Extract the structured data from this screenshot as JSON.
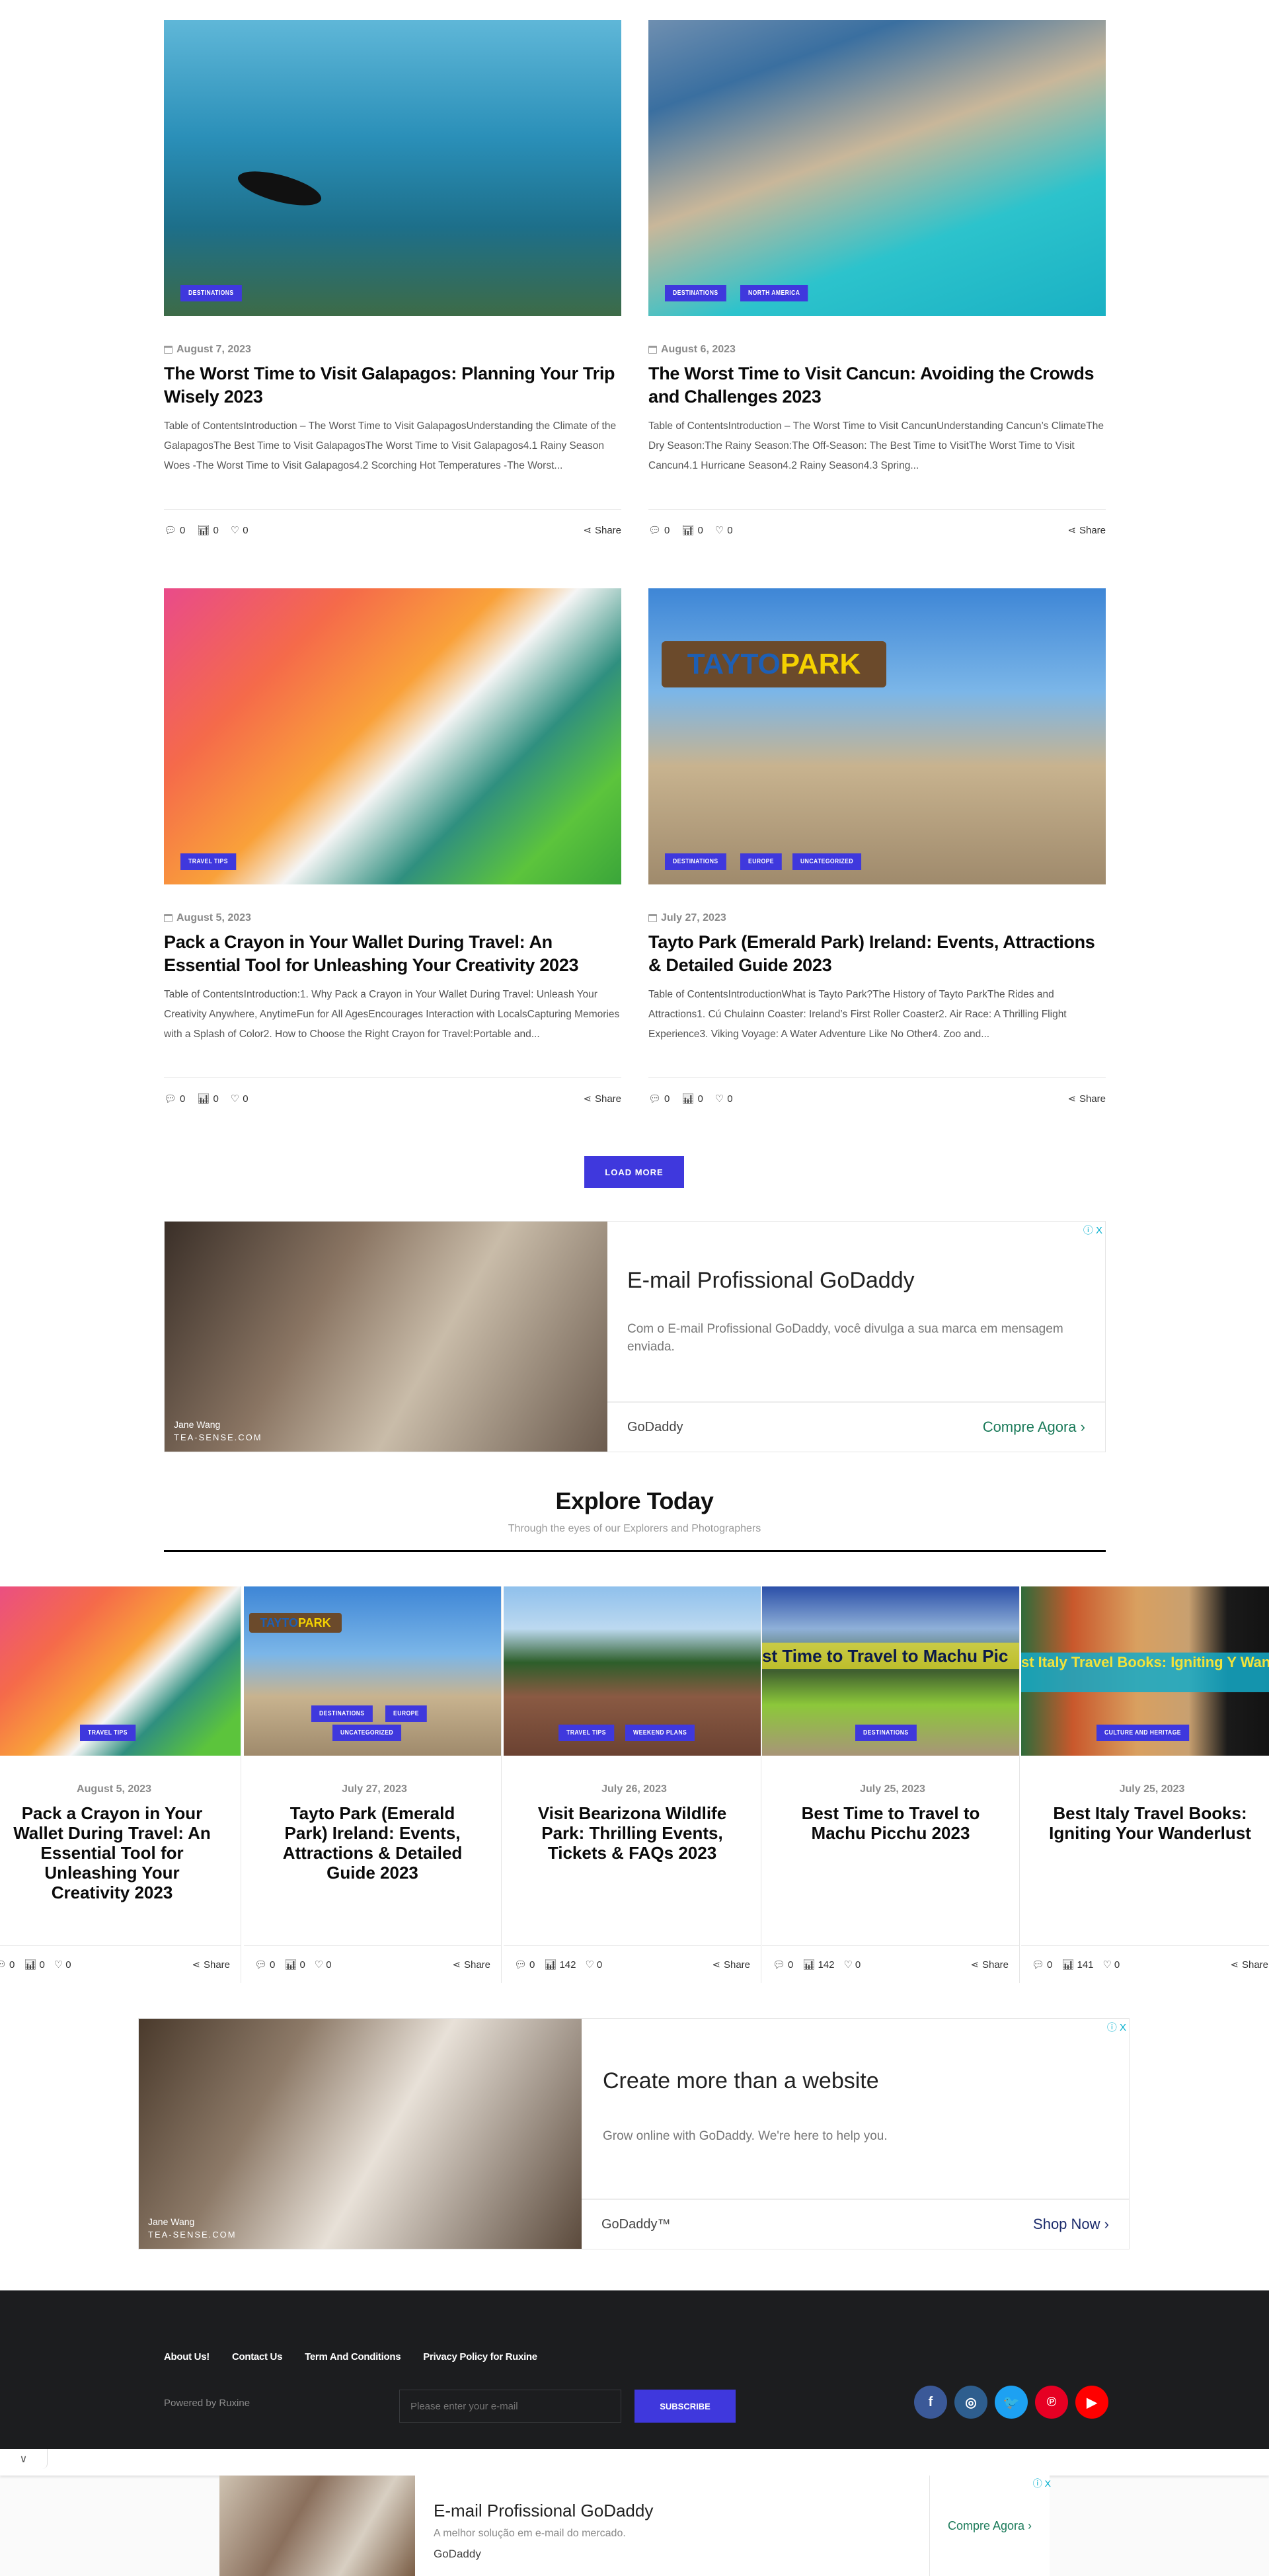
{
  "posts": [
    {
      "date": "August 7, 2023",
      "title": "The Worst Time to Visit Galapagos: Planning Your Trip Wisely 2023",
      "excerpt": "Table of ContentsIntroduction – The Worst Time to Visit GalapagosUnderstanding the Climate of the GalapagosThe Best Time to Visit GalapagosThe Worst Time to Visit Galapagos4.1 Rainy Season Woes -The Worst Time to Visit Galapagos4.2 Scorching Hot Temperatures -The Worst...",
      "categories": [
        "Destinations"
      ],
      "comments": "0",
      "views": "0",
      "likes": "0",
      "share": "Share"
    },
    {
      "date": "August 6, 2023",
      "title": "The Worst Time to Visit Cancun: Avoiding the Crowds and Challenges 2023",
      "excerpt": "Table of ContentsIntroduction – The Worst Time to Visit CancunUnderstanding Cancun’s ClimateThe Dry Season:The Rainy Season:The Off-Season: The Best Time to VisitThe Worst Time to Visit Cancun4.1 Hurricane Season4.2 Rainy Season4.3 Spring...",
      "categories": [
        "Destinations",
        "North America"
      ],
      "comments": "0",
      "views": "0",
      "likes": "0",
      "share": "Share"
    },
    {
      "date": "August 5, 2023",
      "title": "Pack a Crayon in Your Wallet During Travel: An Essential Tool for Unleashing Your Creativity 2023",
      "excerpt": "Table of ContentsIntroduction:1. Why Pack a Crayon in Your Wallet During Travel: Unleash Your Creativity Anywhere, AnytimeFun for All AgesEncourages Interaction with LocalsCapturing Memories with a Splash of Color2. How to Choose the Right Crayon for Travel:Portable and...",
      "categories": [
        "Travel Tips"
      ],
      "comments": "0",
      "views": "0",
      "likes": "0",
      "share": "Share"
    },
    {
      "date": "July 27, 2023",
      "title": "Tayto Park (Emerald Park) Ireland: Events, Attractions & Detailed Guide 2023",
      "excerpt": "Table of ContentsIntroductionWhat is Tayto Park?The History of Tayto ParkThe Rides and Attractions1. Cú Chulainn Coaster: Ireland’s First Roller Coaster2. Air Race: A Thrilling Flight Experience3. Viking Voyage: A Water Adventure Like No Other4. Zoo and...",
      "categories": [
        "Destinations",
        "Europe",
        "Uncategorized"
      ],
      "comments": "0",
      "views": "0",
      "likes": "0",
      "share": "Share"
    }
  ],
  "load_more_label": "LOAD MORE",
  "ad1": {
    "headline": "E-mail Profissional GoDaddy",
    "description": "Com o E-mail Profissional GoDaddy, você divulga a sua marca em mensagem enviada.",
    "brand": "GoDaddy",
    "cta": "Compre Agora",
    "caption_name": "Jane Wang",
    "caption_site": "TEA-SENSE.COM",
    "adchoices": "ⓘ X",
    "cta_color": "#1a7a59"
  },
  "explore": {
    "title": "Explore Today",
    "subtitle": "Through the eyes of our Explorers and Photographers",
    "slides": [
      {
        "date": "August 5, 2023",
        "title": "Pack a Crayon in Your Wallet During Travel: An Essential Tool for Unleashing Your Creativity 2023",
        "categories": [
          "Travel Tips"
        ],
        "comments": "0",
        "views": "0",
        "likes": "0",
        "share": "Share"
      },
      {
        "date": "July 27, 2023",
        "title": "Tayto Park (Emerald Park) Ireland: Events, Attractions & Detailed Guide 2023",
        "categories": [
          "Destinations",
          "Europe",
          "Uncategorized"
        ],
        "comments": "0",
        "views": "0",
        "likes": "0",
        "share": "Share"
      },
      {
        "date": "July 26, 2023",
        "title": "Visit Bearizona Wildlife Park: Thrilling Events, Tickets & FAQs 2023",
        "categories": [
          "Travel Tips",
          "Weekend Plans"
        ],
        "comments": "0",
        "views": "142",
        "likes": "0",
        "share": "Share"
      },
      {
        "date": "July 25, 2023",
        "title": "Best Time to Travel to Machu Picchu 2023",
        "categories": [
          "Destinations"
        ],
        "comments": "0",
        "views": "142",
        "likes": "0",
        "share": "Share",
        "image_text": "st Time to Travel to Machu Pic"
      },
      {
        "date": "July 25, 2023",
        "title": "Best Italy Travel Books: Igniting Your Wanderlust",
        "categories": [
          "Culture and Heritage"
        ],
        "comments": "0",
        "views": "141",
        "likes": "0",
        "share": "Share",
        "image_text": "st Italy Travel Books: Igniting Y Wanderlust"
      }
    ]
  },
  "ad2": {
    "headline": "Create more than a website",
    "description": "Grow online with GoDaddy. We're here to help you.",
    "brand": "GoDaddy™",
    "cta": "Shop Now",
    "caption_name": "Jane Wang",
    "caption_site": "TEA-SENSE.COM",
    "adchoices": "ⓘ X",
    "cta_color": "#1b2a6b"
  },
  "footer": {
    "links": [
      "About Us!",
      "Contact Us",
      "Term And Conditions",
      "Privacy Policy for Ruxine"
    ],
    "powered_by": "Powered by Ruxine",
    "email_placeholder": "Please enter your e-mail",
    "subscribe_label": "SUBSCRIBE",
    "socials": [
      {
        "name": "facebook",
        "glyph": "f",
        "color": "#3b5998"
      },
      {
        "name": "instagram",
        "glyph": "◎",
        "color": "#2e5e8e"
      },
      {
        "name": "twitter",
        "glyph": "🐦",
        "color": "#1da1f2"
      },
      {
        "name": "pinterest",
        "glyph": "℗",
        "color": "#e60023"
      },
      {
        "name": "youtube",
        "glyph": "▶",
        "color": "#ff0000"
      }
    ]
  },
  "sticky_ad": {
    "toggle": "∨",
    "headline": "E-mail Profissional GoDaddy",
    "description": "A melhor solução em e-mail do mercado.",
    "brand": "GoDaddy",
    "cta": "Compre Agora",
    "adchoices": "ⓘ X"
  },
  "accent_color": "#3f38dd"
}
